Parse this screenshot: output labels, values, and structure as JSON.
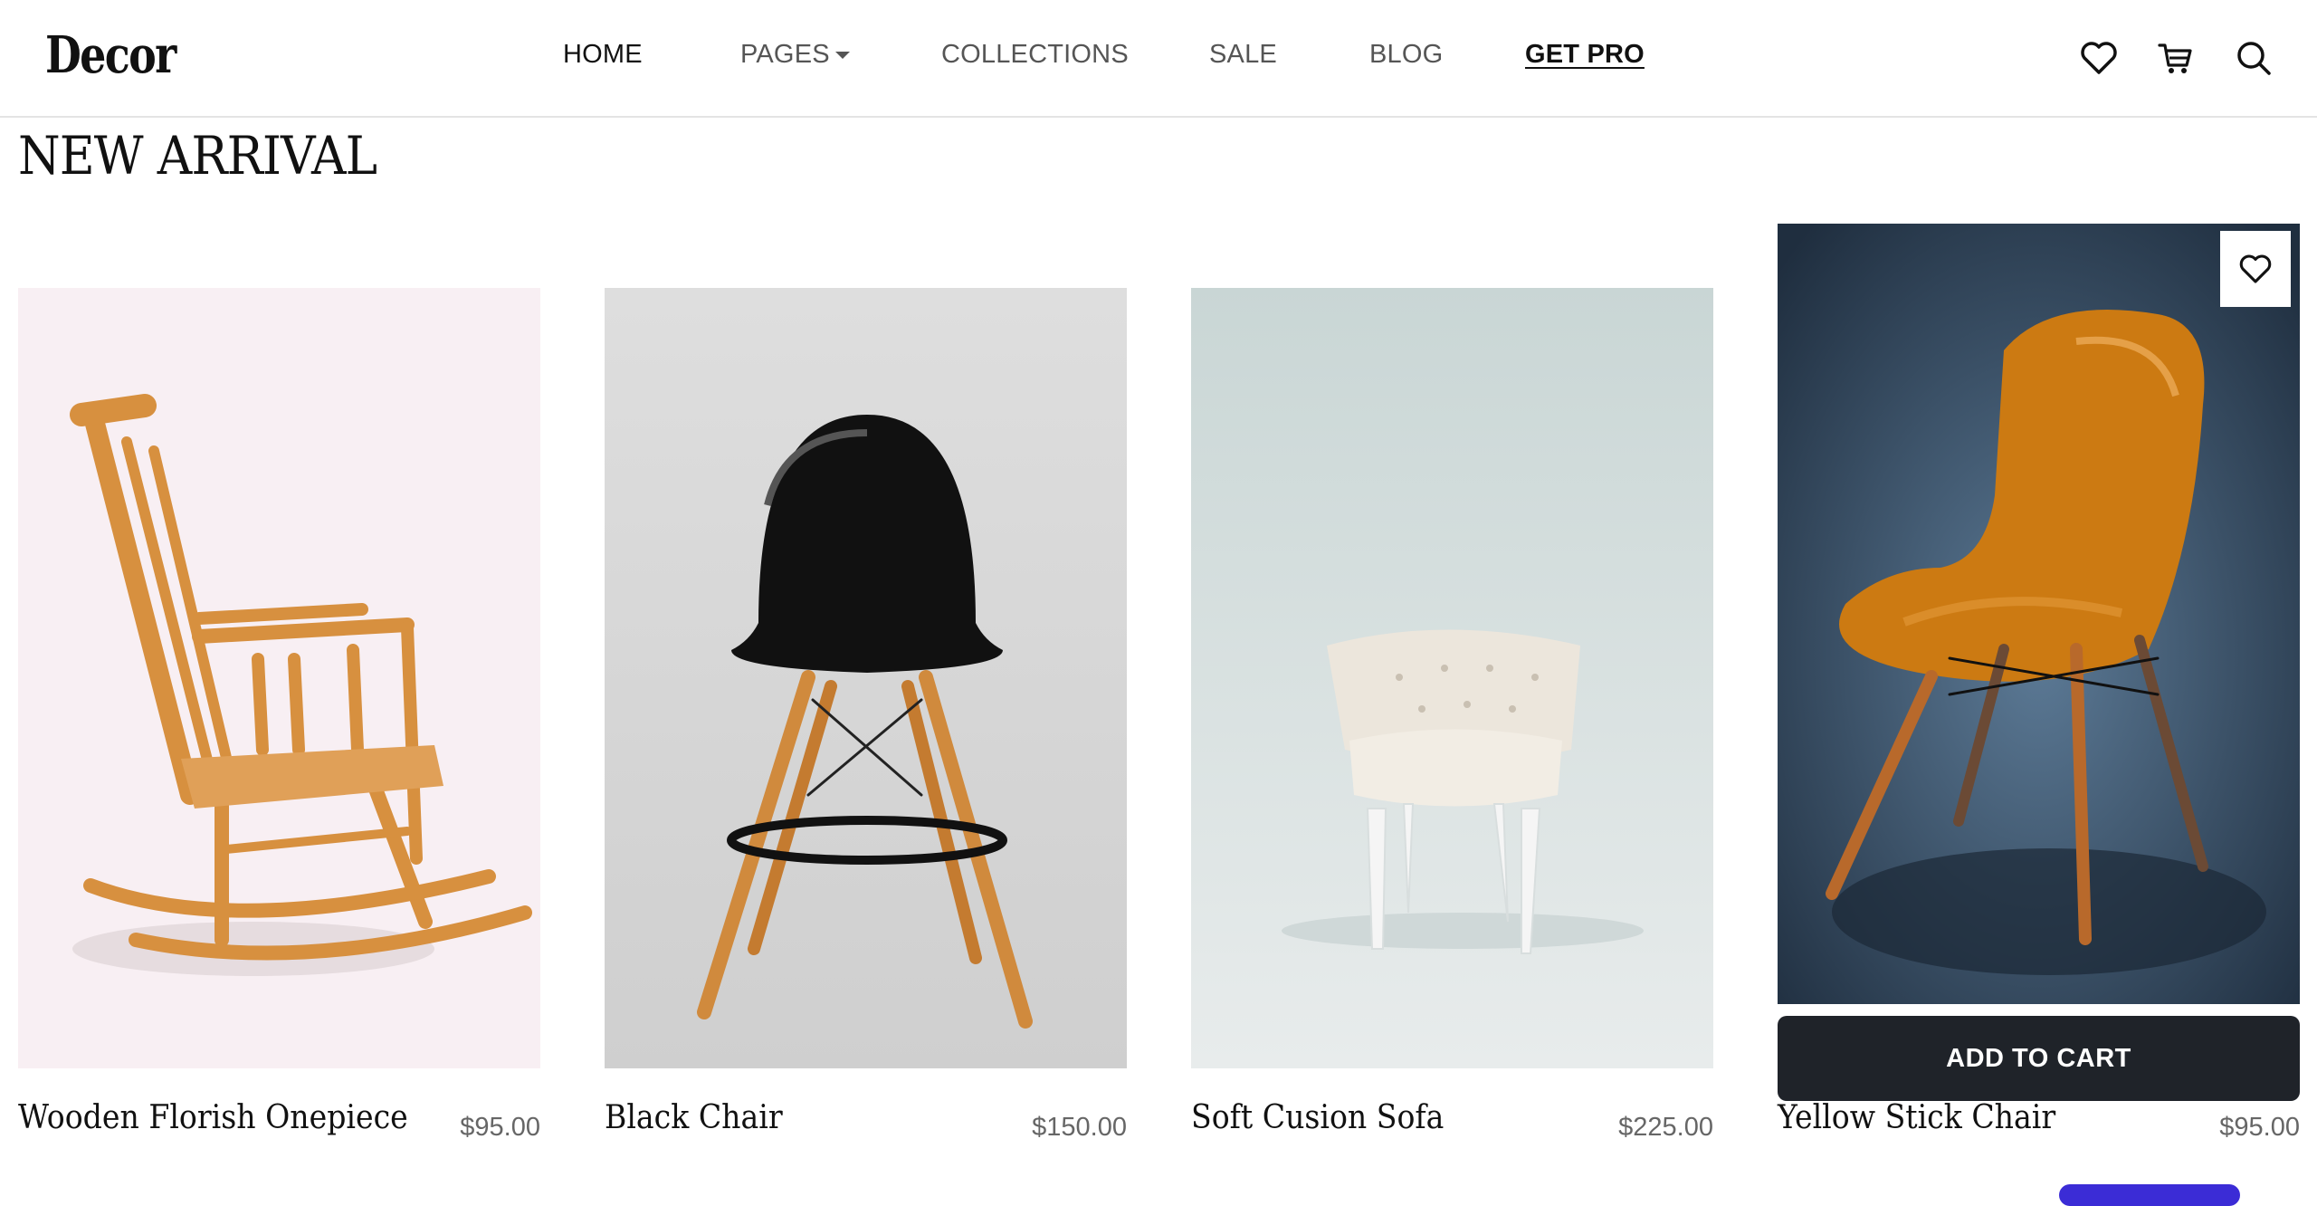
{
  "brand": {
    "logo": "Decor"
  },
  "nav": {
    "items": [
      {
        "label": "HOME"
      },
      {
        "label": "PAGES"
      },
      {
        "label": "COLLECTIONS"
      },
      {
        "label": "SALE"
      },
      {
        "label": "BLOG"
      },
      {
        "label": "GET PRO"
      }
    ]
  },
  "header_icons": [
    "heart-icon",
    "cart-icon",
    "search-icon"
  ],
  "section": {
    "title": "NEW ARRIVAL"
  },
  "products": [
    {
      "name": "Wooden Florish Onepiece",
      "price": "$95.00"
    },
    {
      "name": "Black Chair",
      "price": "$150.00"
    },
    {
      "name": "Soft Cusion Sofa",
      "price": "$225.00"
    },
    {
      "name": "Yellow Stick Chair",
      "price": "$95.00",
      "action": "ADD TO CART"
    }
  ],
  "colors": {
    "text_primary": "#111111",
    "text_muted": "#666666",
    "button_dark": "#1f2329",
    "accent": "#3b2cd6"
  }
}
